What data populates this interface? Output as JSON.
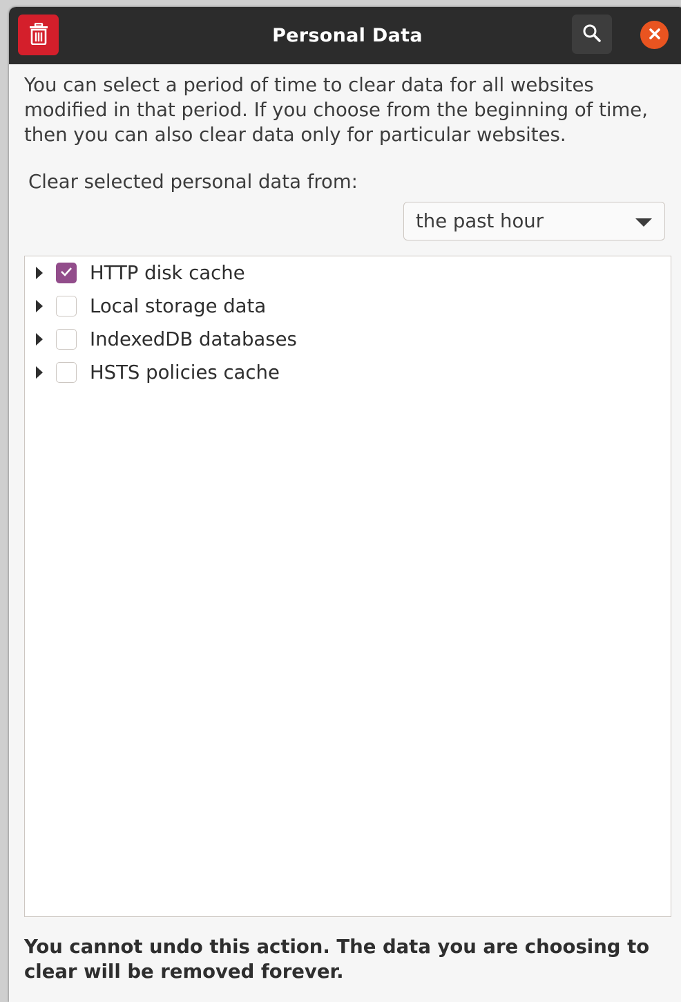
{
  "window": {
    "title": "Personal Data",
    "buttons": {
      "trash_icon": "trash-icon",
      "search_icon": "search-icon",
      "close_icon": "close-icon"
    }
  },
  "description": "You can select a period of time to clear data for all websites modified in that period. If you choose from the beginning of time, then you can also clear data only for particular websites.",
  "period": {
    "label": "Clear selected personal data from:",
    "selected": "the past hour"
  },
  "data_types": [
    {
      "label": "HTTP disk cache",
      "checked": true
    },
    {
      "label": "Local storage data",
      "checked": false
    },
    {
      "label": "IndexedDB databases",
      "checked": false
    },
    {
      "label": "HSTS policies cache",
      "checked": false
    }
  ],
  "warning": "You cannot undo this action. The data you are choosing to clear will be removed forever.",
  "colors": {
    "titlebar": "#2c2c2c",
    "trash_button": "#d41f2b",
    "close_button": "#e95420",
    "checkbox_checked": "#924d8b"
  }
}
